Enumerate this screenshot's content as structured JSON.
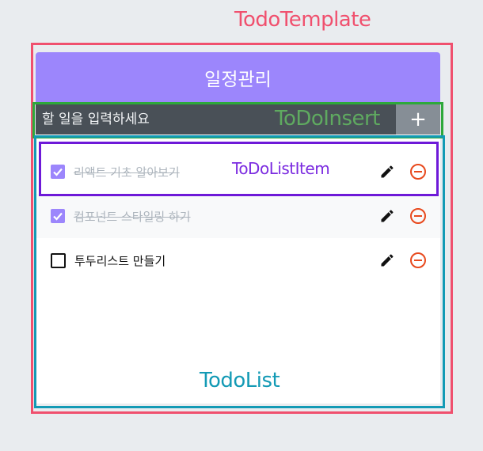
{
  "annotations": {
    "template": "TodoTemplate",
    "insert": "ToDoInsert",
    "list_item": "ToDoListItem",
    "list": "TodoList"
  },
  "title": "일정관리",
  "insert": {
    "placeholder": "할 일을 입력하세요",
    "add_label": "+"
  },
  "todos": [
    {
      "text": "리액트 기초 알아보기",
      "checked": true
    },
    {
      "text": "컴포넌트 스타일링 하기",
      "checked": true
    },
    {
      "text": "투두리스트 만들기",
      "checked": false
    }
  ],
  "icons": {
    "edit": "pencil-icon",
    "remove": "minus-circle-icon",
    "check": "check-icon"
  },
  "colors": {
    "accent": "#9c86fc",
    "remove": "#e8491d"
  }
}
